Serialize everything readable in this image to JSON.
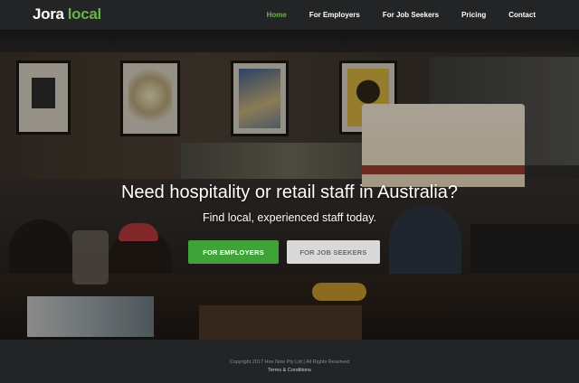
{
  "header": {
    "logo": {
      "part1": "Jora",
      "part2": "local"
    },
    "nav": [
      {
        "label": "Home",
        "active": true
      },
      {
        "label": "For Employers",
        "active": false
      },
      {
        "label": "For Job Seekers",
        "active": false
      },
      {
        "label": "Pricing",
        "active": false
      },
      {
        "label": "Contact",
        "active": false
      }
    ]
  },
  "hero": {
    "title": "Need hospitality or retail staff in Australia?",
    "subtitle": "Find local, experienced staff today.",
    "primary_button": "FOR EMPLOYERS",
    "secondary_button": "FOR JOB SEEKERS"
  },
  "footer": {
    "copyright": "Copyright 2017 Hire Now Pty Ltd  |  All Rights Reserved",
    "terms": "Terms & Conditions"
  },
  "colors": {
    "brand_green": "#6ab04c",
    "button_green": "#3fa33a",
    "header_bg": "#222426",
    "secondary_button_bg": "#d9d9d9"
  }
}
